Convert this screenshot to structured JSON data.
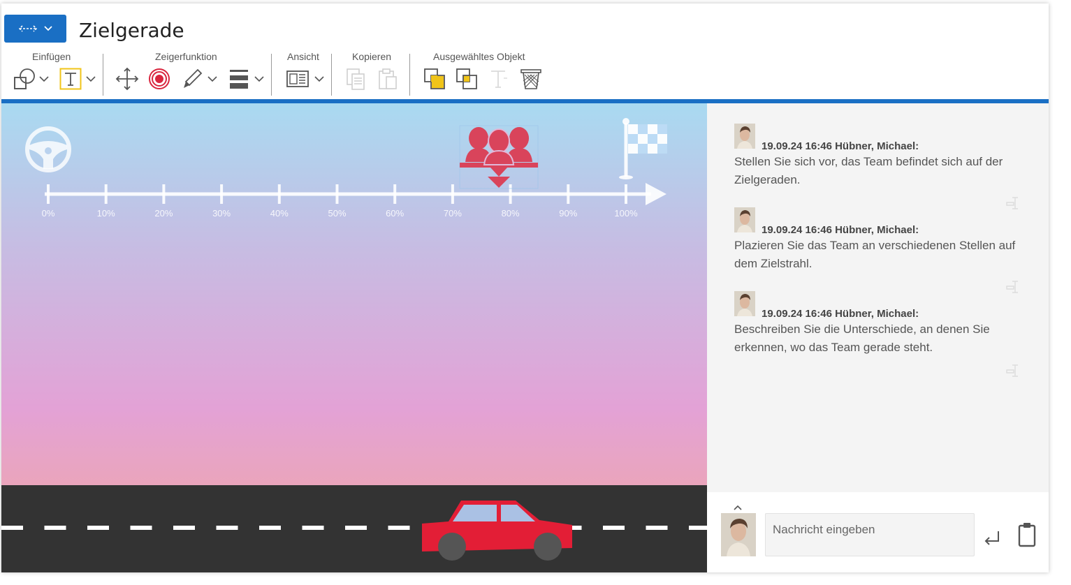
{
  "header": {
    "title": "Zielgerade"
  },
  "toolbar": {
    "groups": [
      {
        "label": "Einfügen"
      },
      {
        "label": "Zeigerfunktion"
      },
      {
        "label": "Ansicht"
      },
      {
        "label": "Kopieren"
      },
      {
        "label": "Ausgewähltes Objekt"
      }
    ]
  },
  "canvas": {
    "axis_ticks": [
      "0%",
      "10%",
      "20%",
      "30%",
      "40%",
      "50%",
      "60%",
      "70%",
      "80%",
      "90%",
      "100%"
    ],
    "team_marker_position_percent": 78,
    "colors": {
      "sky_top": "#a9daf1",
      "sky_bottom": "#f2a89e",
      "road": "#333333",
      "car": "#e31e36",
      "team": "#d9445b"
    }
  },
  "chat": {
    "messages": [
      {
        "header": "19.09.24 16:46 Hübner, Michael:",
        "text": "Stellen Sie sich vor, das Team befindet sich auf der Zielgeraden."
      },
      {
        "header": "19.09.24 16:46 Hübner, Michael:",
        "text": "Plazieren Sie das Team an verschiedenen Stellen auf dem Zielstrahl."
      },
      {
        "header": "19.09.24 16:46 Hübner, Michael:",
        "text": "Beschreiben Sie die Unterschiede, an denen Sie erkennen, wo das Team gerade steht."
      }
    ],
    "input": {
      "placeholder": "Nachricht eingeben"
    }
  },
  "accent_color": "#1a6fc4"
}
